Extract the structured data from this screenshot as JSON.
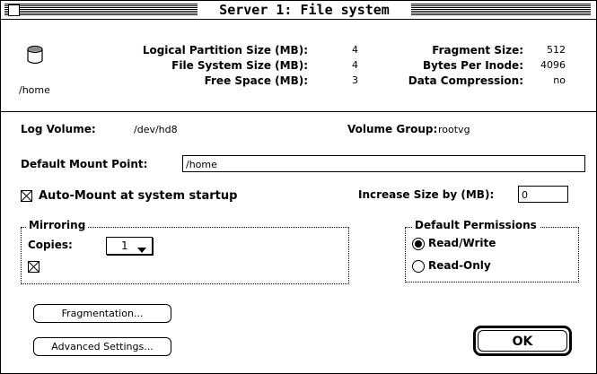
{
  "window": {
    "title": "Server 1: File system"
  },
  "header": {
    "mount_name": "/home",
    "stats_left": [
      {
        "label": "Logical Partition Size (MB):",
        "value": "4"
      },
      {
        "label": "File System Size (MB):",
        "value": "4"
      },
      {
        "label": "Free Space (MB):",
        "value": "3"
      }
    ],
    "stats_right": [
      {
        "label": "Fragment Size:",
        "value": "512"
      },
      {
        "label": "Bytes Per Inode:",
        "value": "4096"
      },
      {
        "label": "Data Compression:",
        "value": "no"
      }
    ]
  },
  "form": {
    "log_volume_label": "Log Volume:",
    "log_volume_value": "/dev/hd8",
    "volume_group_label": "Volume Group:",
    "volume_group_value": "rootvg",
    "mount_point_label": "Default Mount Point:",
    "mount_point_value": "/home",
    "automount_label": "Auto-Mount at system startup",
    "automount_checked": true,
    "increase_size_label": "Increase Size by (MB):",
    "increase_size_value": "0"
  },
  "mirroring": {
    "legend": "Mirroring",
    "copies_label": "Copies:",
    "copies_value": "1",
    "checkbox_checked": true
  },
  "permissions": {
    "legend": "Default Permissions",
    "options": [
      {
        "label": "Read/Write",
        "selected": true
      },
      {
        "label": "Read-Only",
        "selected": false
      }
    ]
  },
  "buttons": {
    "fragmentation": "Fragmentation...",
    "advanced": "Advanced Settings...",
    "ok": "OK"
  }
}
